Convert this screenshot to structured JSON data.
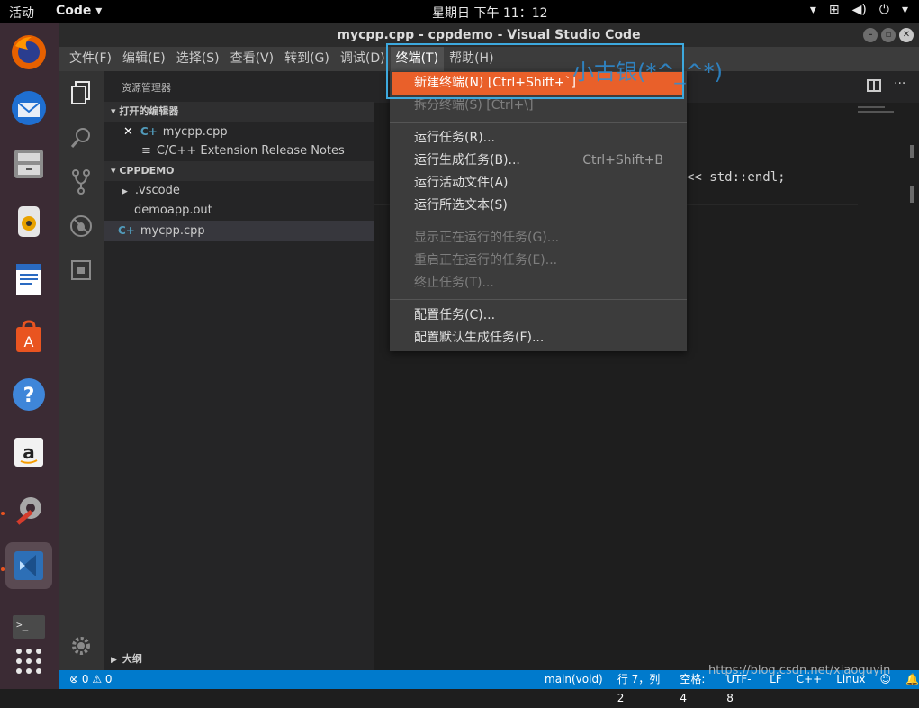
{
  "topbar": {
    "activities": "活动",
    "app_menu": "Code ▾",
    "clock": "星期日 下午 11：12",
    "tray": [
      "▾",
      "⊞",
      "◀)",
      "⏻",
      "▾"
    ]
  },
  "window": {
    "title": "mycpp.cpp - cppdemo - Visual Studio Code"
  },
  "menubar": [
    "文件(F)",
    "编辑(E)",
    "选择(S)",
    "查看(V)",
    "转到(G)",
    "调试(D)",
    "终端(T)",
    "帮助(H)"
  ],
  "sidebar": {
    "title": "资源管理器",
    "open_editors": {
      "header": "▾ 打开的编辑器",
      "items": [
        "mycpp.cpp",
        "C/C++ Extension Release Notes"
      ]
    },
    "project": {
      "header": "▾ CPPDEMO",
      "items": [
        ".vscode",
        "demoapp.out",
        "mycpp.cpp"
      ]
    },
    "outline": "大纲"
  },
  "editor": {
    "visible_code": "<< std::endl;"
  },
  "terminal_menu": {
    "items": [
      {
        "label": "新建终端(N) [Ctrl+Shift+`]",
        "key": ""
      },
      {
        "label": "拆分终端(S) [Ctrl+\\]",
        "key": ""
      },
      {
        "label": "运行任务(R)...",
        "key": ""
      },
      {
        "label": "运行生成任务(B)...",
        "key": "Ctrl+Shift+B"
      },
      {
        "label": "运行活动文件(A)",
        "key": ""
      },
      {
        "label": "运行所选文本(S)",
        "key": ""
      },
      {
        "label": "显示正在运行的任务(G)...",
        "key": ""
      },
      {
        "label": "重启正在运行的任务(E)...",
        "key": ""
      },
      {
        "label": "终止任务(T)...",
        "key": ""
      },
      {
        "label": "配置任务(C)...",
        "key": ""
      },
      {
        "label": "配置默认生成任务(F)...",
        "key": ""
      }
    ]
  },
  "annotation": "小古银(*^_^*)",
  "statusbar": {
    "problems": "⊗ 0 ⚠ 0",
    "scope": "main(void)",
    "position": "行 7，列 2",
    "spaces": "空格: 4",
    "encoding": "UTF-8",
    "eol": "LF",
    "language": "C++",
    "platform": "Linux"
  },
  "watermark": "https://blog.csdn.net/xiaoguyin",
  "colors": {
    "accent": "#e9602a",
    "statusbar": "#007acc",
    "annotation": "#3da9de"
  }
}
